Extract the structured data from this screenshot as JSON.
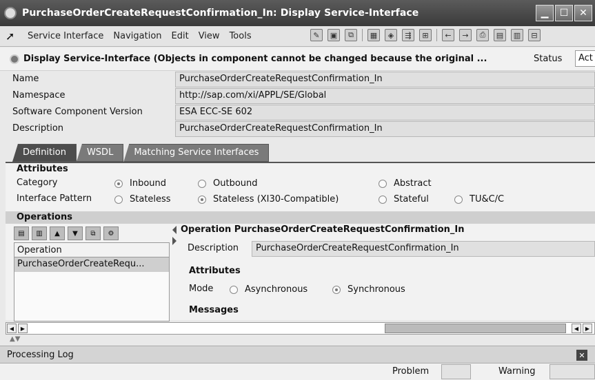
{
  "window": {
    "title": "PurchaseOrderCreateRequestConfirmation_In: Display Service-Interface"
  },
  "menu": {
    "items": [
      "Service Interface",
      "Navigation",
      "Edit",
      "View",
      "Tools"
    ]
  },
  "infobar": {
    "message": "Display Service-Interface (Objects in component cannot be changed because the original ...",
    "status_label": "Status",
    "status_value": "Act"
  },
  "fields": [
    {
      "label": "Name",
      "value": "PurchaseOrderCreateRequestConfirmation_In"
    },
    {
      "label": "Namespace",
      "value": "http://sap.com/xi/APPL/SE/Global"
    },
    {
      "label": "Software Component Version",
      "value": "ESA ECC-SE 602"
    },
    {
      "label": "Description",
      "value": "PurchaseOrderCreateRequestConfirmation_In"
    }
  ],
  "tabs": [
    "Definition",
    "WSDL",
    "Matching Service Interfaces"
  ],
  "attributes": {
    "title": "Attributes",
    "category_label": "Category",
    "category_options": [
      "Inbound",
      "Outbound",
      "Abstract"
    ],
    "category_selected": "Inbound",
    "pattern_label": "Interface Pattern",
    "pattern_options": [
      "Stateless",
      "Stateless (XI30-Compatible)",
      "Stateful",
      "TU&C/C"
    ],
    "pattern_selected": "Stateless (XI30-Compatible)"
  },
  "operations": {
    "title": "Operations",
    "column_header": "Operation",
    "rows": [
      "PurchaseOrderCreateRequ..."
    ]
  },
  "operation_detail": {
    "title": "Operation PurchaseOrderCreateRequestConfirmation_In",
    "description_label": "Description",
    "description_value": "PurchaseOrderCreateRequestConfirmation_In",
    "attributes_title": "Attributes",
    "mode_label": "Mode",
    "mode_options": [
      "Asynchronous",
      "Synchronous"
    ],
    "mode_selected": "Synchronous",
    "messages_title": "Messages"
  },
  "log": {
    "title": "Processing Log",
    "problem_label": "Problem",
    "warning_label": "Warning"
  }
}
